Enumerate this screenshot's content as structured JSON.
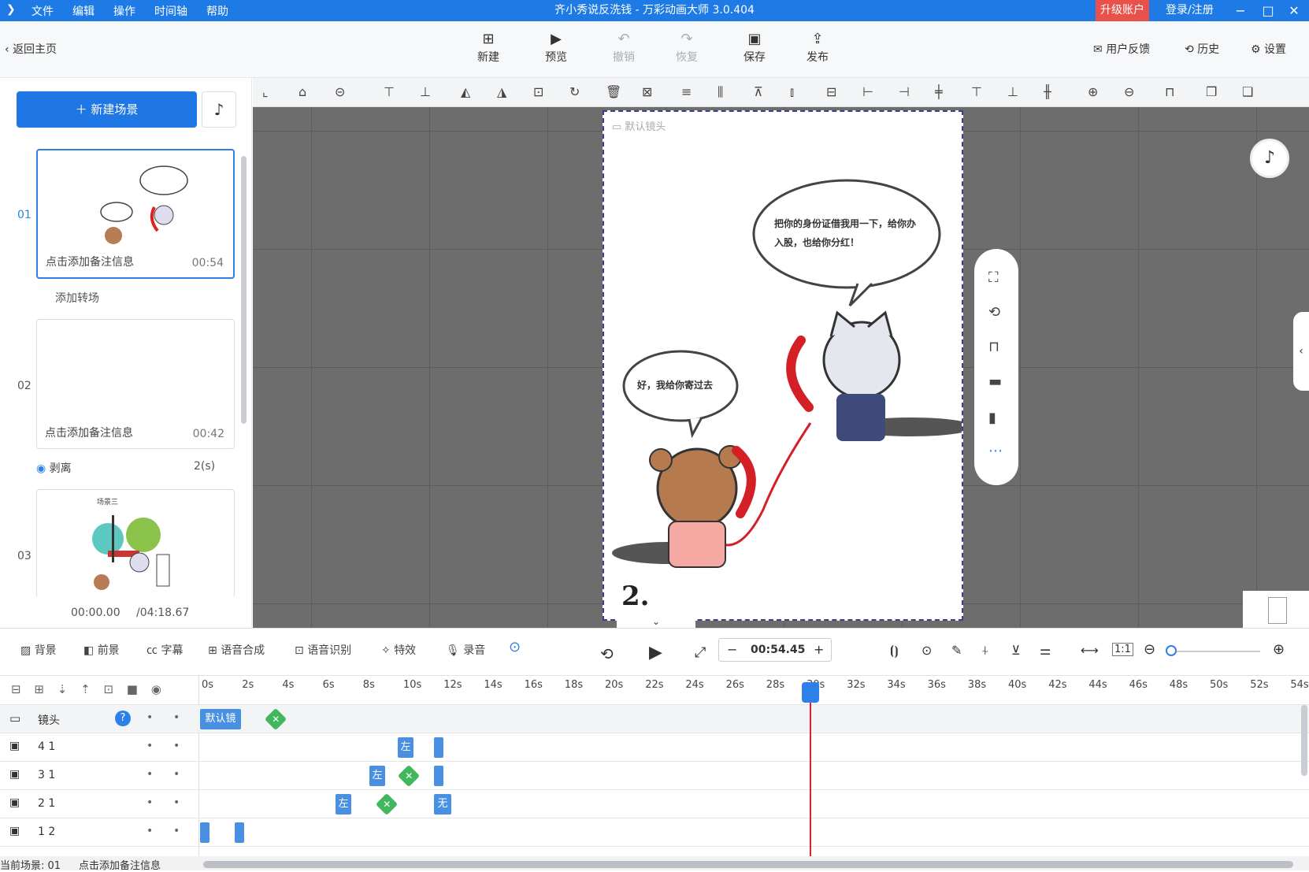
{
  "app": {
    "menu": [
      "文件",
      "编辑",
      "操作",
      "时间轴",
      "帮助"
    ],
    "title": "齐小秀说反洗钱 - 万彩动画大师 3.0.404",
    "upgrade": "升级账户",
    "login": "登录/注册"
  },
  "toolbar": {
    "back": "返回主页",
    "buttons": [
      {
        "label": "新建",
        "icon": "new-icon"
      },
      {
        "label": "预览",
        "icon": "play-icon"
      },
      {
        "label": "撤销",
        "icon": "undo-icon",
        "disabled": true
      },
      {
        "label": "恢复",
        "icon": "redo-icon",
        "disabled": true
      },
      {
        "label": "保存",
        "icon": "save-icon"
      },
      {
        "label": "发布",
        "icon": "publish-icon"
      }
    ],
    "feedback": "用户反馈",
    "history": "历史",
    "settings": "设置"
  },
  "sidebar": {
    "new_scene": "新建场景",
    "scenes": [
      {
        "num": "01",
        "note": "点击添加备注信息",
        "time": "00:54"
      },
      {
        "num": "02",
        "note": "点击添加备注信息",
        "time": "00:42"
      },
      {
        "num": "03"
      }
    ],
    "transition1": "添加转场",
    "transition2": "剥离",
    "transition2_time": "2(s)",
    "time_current": "00:00.00",
    "time_total": "/04:18.67",
    "scene3_label": "场景三"
  },
  "canvas": {
    "camera_label": "默认镜头",
    "bubble1": "把你的身份证借我用一下，给你办入股，也给你分红！",
    "bubble2": "好，我给你寄过去",
    "page_num": "2."
  },
  "timebar": {
    "items": [
      "背景",
      "前景",
      "字幕",
      "语音合成",
      "语音识别",
      "特效",
      "录音"
    ],
    "time": "00:54.45"
  },
  "timeline": {
    "ticks": [
      "0s",
      "2s",
      "4s",
      "6s",
      "8s",
      "10s",
      "12s",
      "14s",
      "16s",
      "18s",
      "20s",
      "22s",
      "24s",
      "26s",
      "28s",
      "30s",
      "32s",
      "34s",
      "36s",
      "38s",
      "40s",
      "42s",
      "44s",
      "46s",
      "48s",
      "50s",
      "52s",
      "54s"
    ],
    "rows": [
      {
        "label": "镜头"
      },
      {
        "label": "4 1"
      },
      {
        "label": "3 1"
      },
      {
        "label": "2 1"
      },
      {
        "label": "1 2"
      }
    ],
    "camera_clip": "默认镜",
    "clip_left": "左",
    "clip_none": "无"
  },
  "status": {
    "current_scene": "当前场景: 01",
    "note": "点击添加备注信息"
  }
}
